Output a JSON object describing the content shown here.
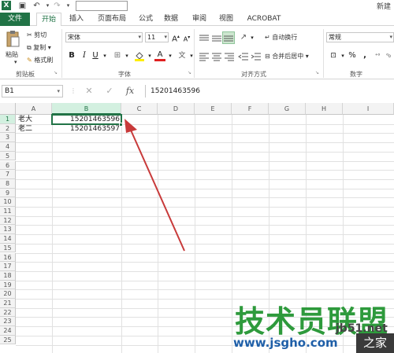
{
  "titlebar": {
    "app_icon": "excel-logo",
    "right_text": "新建"
  },
  "tabs": [
    {
      "label": "文件"
    },
    {
      "label": "开始"
    },
    {
      "label": "插入"
    },
    {
      "label": "页面布局"
    },
    {
      "label": "公式"
    },
    {
      "label": "数据"
    },
    {
      "label": "审阅"
    },
    {
      "label": "视图"
    },
    {
      "label": "ACROBAT"
    }
  ],
  "ribbon": {
    "clipboard": {
      "paste": "粘贴",
      "cut": "剪切",
      "copy": "复制",
      "format_painter": "格式刷",
      "group_label": "剪贴板"
    },
    "font": {
      "font_name": "宋体",
      "font_size": "11",
      "grow": "A",
      "shrink": "A",
      "bold": "B",
      "italic": "I",
      "underline": "U",
      "color_glyph": "A",
      "wen": "文",
      "group_label": "字体"
    },
    "alignment": {
      "wrap_text": "自动换行",
      "merge_center": "合并后居中",
      "group_label": "对齐方式"
    },
    "number": {
      "format": "常规",
      "percent": "%",
      "comma": ",",
      "group_label": "数字"
    }
  },
  "formula_bar": {
    "name_box": "B1",
    "fx": "fx",
    "content": "15201463596"
  },
  "grid": {
    "columns": [
      "A",
      "B",
      "C",
      "D",
      "E",
      "F",
      "G",
      "H",
      "I"
    ],
    "rows": [
      "1",
      "2",
      "3",
      "4",
      "5",
      "6",
      "7",
      "8",
      "9",
      "10",
      "11",
      "12",
      "13",
      "14",
      "15",
      "16",
      "17",
      "18",
      "19",
      "20",
      "21",
      "22",
      "23",
      "24",
      "25"
    ],
    "cells": {
      "A1": "老大",
      "B1": "15201463596",
      "A2": "老二",
      "B2": "15201463597"
    },
    "selected_column": "B",
    "selected_row": "1"
  },
  "watermark": {
    "brand": "技术员联盟",
    "url": "www.jsgho.com",
    "side": "jb51.net",
    "jia": "之家"
  },
  "colors": {
    "accent": "#217346",
    "arrow": "#c83a3a"
  }
}
